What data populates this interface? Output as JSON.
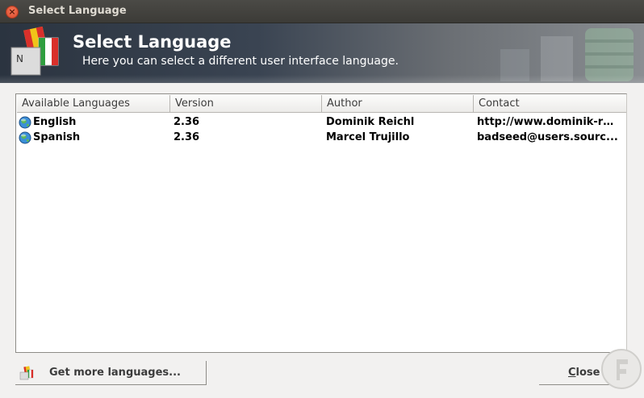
{
  "window": {
    "title": "Select Language",
    "close_icon": "close-icon"
  },
  "banner": {
    "title": "Select Language",
    "subtitle": "Here you can select a different user interface language.",
    "icon": "language-flags-icon"
  },
  "list": {
    "columns": [
      "Available Languages",
      "Version",
      "Author",
      "Contact"
    ],
    "rows": [
      {
        "icon": "globe-icon",
        "language": "English",
        "version": "2.36",
        "author": "Dominik Reichl",
        "contact": "http://www.dominik-re..."
      },
      {
        "icon": "globe-icon",
        "language": "Spanish",
        "version": "2.36",
        "author": "Marcel Trujillo",
        "contact": "badseed@users.sourc..."
      }
    ]
  },
  "buttons": {
    "get_more": "Get more languages...",
    "close": "Close"
  }
}
